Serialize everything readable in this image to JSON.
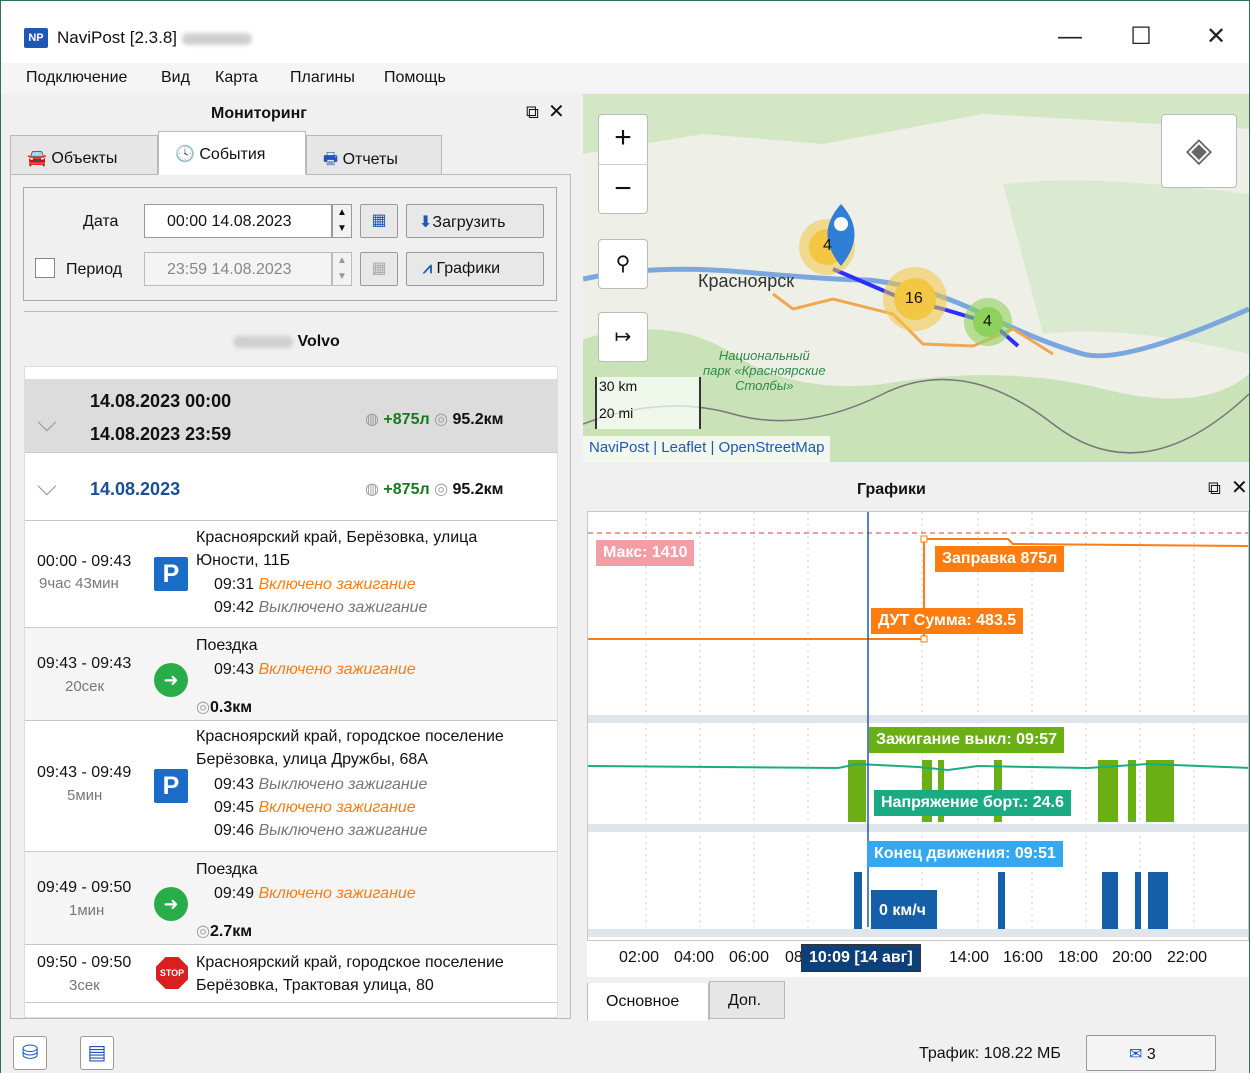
{
  "window": {
    "title": "NaviPost [2.3.8]",
    "logo": "NP",
    "minimize": "—",
    "maximize": "☐",
    "close": "✕"
  },
  "menu": [
    "Подключение",
    "Вид",
    "Карта",
    "Плагины",
    "Помощь"
  ],
  "monitoring": {
    "title": "Мониторинг",
    "tabs": [
      "Объекты",
      "События",
      "Отчеты"
    ],
    "filter": {
      "date_label": "Дата",
      "date_value": "00:00 14.08.2023",
      "period_label": "Период",
      "period_value": "23:59 14.08.2023",
      "load_button": "Загрузить",
      "charts_button": "Графики"
    },
    "vehicle": "Volvo",
    "summary": {
      "start": "14.08.2023 00:00",
      "end": "14.08.2023 23:59",
      "fuel": "+875л",
      "distance": "95.2км"
    },
    "day": {
      "date": "14.08.2023",
      "fuel": "+875л",
      "distance": "95.2км"
    },
    "events": [
      {
        "time": "00:00 - 09:43",
        "duration": "9час 43мин",
        "icon": "parking-icon",
        "address": [
          "Красноярский край, Берёзовка, улица",
          "Юности, 11Б"
        ],
        "items": [
          {
            "t": "09:31",
            "text": "Включено зажигание",
            "state": "on"
          },
          {
            "t": "09:42",
            "text": "Выключено зажигание",
            "state": "off"
          }
        ]
      },
      {
        "time": "09:43 - 09:43",
        "duration": "20сек",
        "icon": "trip-icon",
        "title": "Поездка",
        "items": [
          {
            "t": "09:43",
            "text": "Включено зажигание",
            "state": "on"
          }
        ],
        "distance": "0.3км"
      },
      {
        "time": "09:43 - 09:49",
        "duration": "5мин",
        "icon": "parking-icon",
        "address": [
          "Красноярский край, городское поселение",
          "Берёзовка, улица Дружбы, 68А"
        ],
        "items": [
          {
            "t": "09:43",
            "text": "Выключено зажигание",
            "state": "off"
          },
          {
            "t": "09:45",
            "text": "Включено зажигание",
            "state": "on"
          },
          {
            "t": "09:46",
            "text": "Выключено зажигание",
            "state": "off"
          }
        ]
      },
      {
        "time": "09:49 - 09:50",
        "duration": "1мин",
        "icon": "trip-icon",
        "title": "Поездка",
        "items": [
          {
            "t": "09:49",
            "text": "Включено зажигание",
            "state": "on"
          }
        ],
        "distance": "2.7км"
      },
      {
        "time": "09:50 - 09:50",
        "duration": "3сек",
        "icon": "stop-icon",
        "address": [
          "Красноярский край, городское поселение",
          "Берёзовка, Трактовая улица, 80"
        ],
        "items": []
      }
    ]
  },
  "map": {
    "zoom_in": "+",
    "zoom_out": "−",
    "search": "⚲",
    "route": "↦",
    "city": "Красноярск",
    "park": [
      "Национальный",
      "парк «Красноярские",
      "Столбы»"
    ],
    "clusters": [
      "4",
      "16",
      "4"
    ],
    "scale_km": "30 km",
    "scale_mi": "20 mi",
    "attribution": "NaviPost | Leaflet | OpenStreetMap"
  },
  "charts": {
    "title": "Графики",
    "max_label": "Макс: 1410",
    "refuel_label": "Заправка 875л",
    "fuel_sum_label": "ДУТ Сумма: 483.5",
    "ignition_label": "Зажигание выкл: 09:57",
    "voltage_label": "Напряжение борт.: 24.6",
    "motion_label": "Конец движения: 09:51",
    "speed_label": "0 км/ч",
    "cursor_label": "10:09 [14 авг]",
    "x_ticks": [
      "02:00",
      "04:00",
      "06:00",
      "08",
      "14:00",
      "16:00",
      "18:00",
      "20:00",
      "22:00"
    ],
    "tabs": [
      "Основное",
      "Доп."
    ]
  },
  "status": {
    "traffic": "Трафик: 108.22 МБ",
    "messages": "3"
  },
  "colors": {
    "fuel": "#ff7c10",
    "ignition": "#6ab014",
    "voltage": "#1bab83",
    "motion": "#155fa8",
    "cursor": "#1f57b5"
  }
}
